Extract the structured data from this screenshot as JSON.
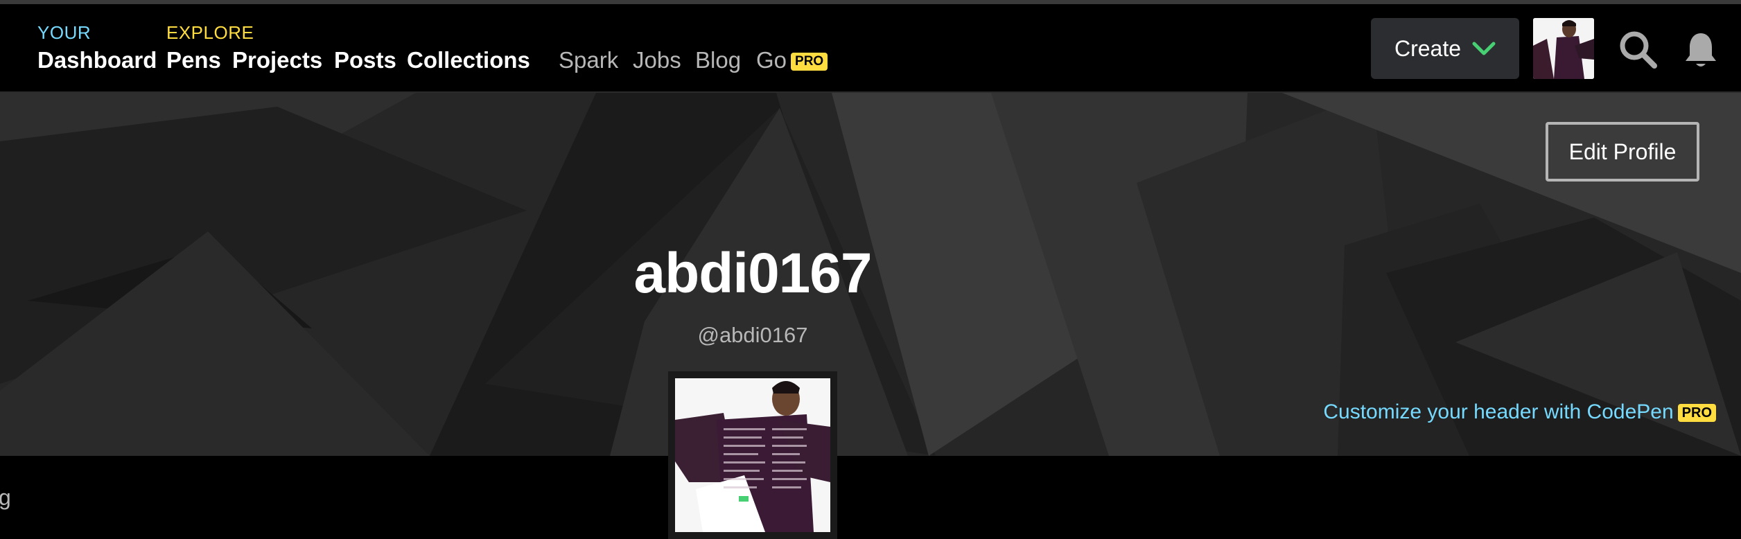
{
  "nav": {
    "your_label": "YOUR",
    "explore_label": "EXPLORE",
    "dashboard": "Dashboard",
    "pens": "Pens",
    "projects": "Projects",
    "posts": "Posts",
    "collections": "Collections",
    "spark": "Spark",
    "jobs": "Jobs",
    "blog": "Blog",
    "go": "Go",
    "go_badge": "PRO",
    "create": "Create"
  },
  "icons": {
    "create_chevron": "chevron-down-icon",
    "search": "search-icon",
    "notifications": "bell-icon"
  },
  "profile": {
    "display_name": "abdi0167",
    "handle": "@abdi0167",
    "edit_button": "Edit Profile",
    "customize_text": "Customize your header with CodePen",
    "customize_badge": "PRO"
  },
  "partial_text": "g",
  "colors": {
    "your_accent": "#76daff",
    "explore_accent": "#ffdd40",
    "pro_badge": "#ffdd40",
    "create_chevron": "#47cf73"
  }
}
